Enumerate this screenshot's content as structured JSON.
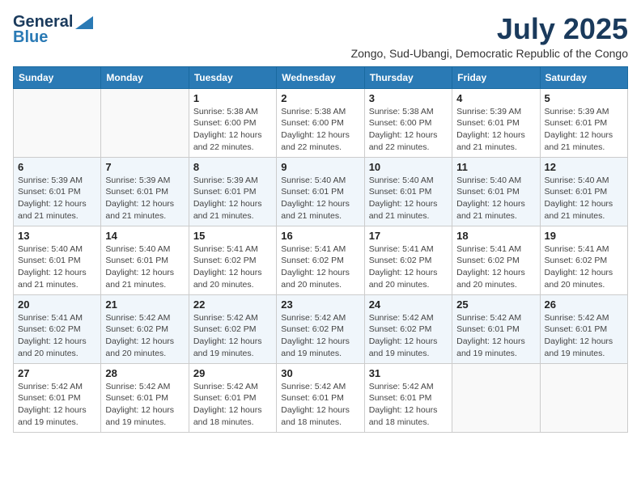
{
  "logo": {
    "line1": "General",
    "line2": "Blue"
  },
  "title": "July 2025",
  "location": "Zongo, Sud-Ubangi, Democratic Republic of the Congo",
  "weekdays": [
    "Sunday",
    "Monday",
    "Tuesday",
    "Wednesday",
    "Thursday",
    "Friday",
    "Saturday"
  ],
  "weeks": [
    [
      {
        "day": "",
        "info": ""
      },
      {
        "day": "",
        "info": ""
      },
      {
        "day": "1",
        "info": "Sunrise: 5:38 AM\nSunset: 6:00 PM\nDaylight: 12 hours and 22 minutes."
      },
      {
        "day": "2",
        "info": "Sunrise: 5:38 AM\nSunset: 6:00 PM\nDaylight: 12 hours and 22 minutes."
      },
      {
        "day": "3",
        "info": "Sunrise: 5:38 AM\nSunset: 6:00 PM\nDaylight: 12 hours and 22 minutes."
      },
      {
        "day": "4",
        "info": "Sunrise: 5:39 AM\nSunset: 6:01 PM\nDaylight: 12 hours and 21 minutes."
      },
      {
        "day": "5",
        "info": "Sunrise: 5:39 AM\nSunset: 6:01 PM\nDaylight: 12 hours and 21 minutes."
      }
    ],
    [
      {
        "day": "6",
        "info": "Sunrise: 5:39 AM\nSunset: 6:01 PM\nDaylight: 12 hours and 21 minutes."
      },
      {
        "day": "7",
        "info": "Sunrise: 5:39 AM\nSunset: 6:01 PM\nDaylight: 12 hours and 21 minutes."
      },
      {
        "day": "8",
        "info": "Sunrise: 5:39 AM\nSunset: 6:01 PM\nDaylight: 12 hours and 21 minutes."
      },
      {
        "day": "9",
        "info": "Sunrise: 5:40 AM\nSunset: 6:01 PM\nDaylight: 12 hours and 21 minutes."
      },
      {
        "day": "10",
        "info": "Sunrise: 5:40 AM\nSunset: 6:01 PM\nDaylight: 12 hours and 21 minutes."
      },
      {
        "day": "11",
        "info": "Sunrise: 5:40 AM\nSunset: 6:01 PM\nDaylight: 12 hours and 21 minutes."
      },
      {
        "day": "12",
        "info": "Sunrise: 5:40 AM\nSunset: 6:01 PM\nDaylight: 12 hours and 21 minutes."
      }
    ],
    [
      {
        "day": "13",
        "info": "Sunrise: 5:40 AM\nSunset: 6:01 PM\nDaylight: 12 hours and 21 minutes."
      },
      {
        "day": "14",
        "info": "Sunrise: 5:40 AM\nSunset: 6:01 PM\nDaylight: 12 hours and 21 minutes."
      },
      {
        "day": "15",
        "info": "Sunrise: 5:41 AM\nSunset: 6:02 PM\nDaylight: 12 hours and 20 minutes."
      },
      {
        "day": "16",
        "info": "Sunrise: 5:41 AM\nSunset: 6:02 PM\nDaylight: 12 hours and 20 minutes."
      },
      {
        "day": "17",
        "info": "Sunrise: 5:41 AM\nSunset: 6:02 PM\nDaylight: 12 hours and 20 minutes."
      },
      {
        "day": "18",
        "info": "Sunrise: 5:41 AM\nSunset: 6:02 PM\nDaylight: 12 hours and 20 minutes."
      },
      {
        "day": "19",
        "info": "Sunrise: 5:41 AM\nSunset: 6:02 PM\nDaylight: 12 hours and 20 minutes."
      }
    ],
    [
      {
        "day": "20",
        "info": "Sunrise: 5:41 AM\nSunset: 6:02 PM\nDaylight: 12 hours and 20 minutes."
      },
      {
        "day": "21",
        "info": "Sunrise: 5:42 AM\nSunset: 6:02 PM\nDaylight: 12 hours and 20 minutes."
      },
      {
        "day": "22",
        "info": "Sunrise: 5:42 AM\nSunset: 6:02 PM\nDaylight: 12 hours and 19 minutes."
      },
      {
        "day": "23",
        "info": "Sunrise: 5:42 AM\nSunset: 6:02 PM\nDaylight: 12 hours and 19 minutes."
      },
      {
        "day": "24",
        "info": "Sunrise: 5:42 AM\nSunset: 6:02 PM\nDaylight: 12 hours and 19 minutes."
      },
      {
        "day": "25",
        "info": "Sunrise: 5:42 AM\nSunset: 6:01 PM\nDaylight: 12 hours and 19 minutes."
      },
      {
        "day": "26",
        "info": "Sunrise: 5:42 AM\nSunset: 6:01 PM\nDaylight: 12 hours and 19 minutes."
      }
    ],
    [
      {
        "day": "27",
        "info": "Sunrise: 5:42 AM\nSunset: 6:01 PM\nDaylight: 12 hours and 19 minutes."
      },
      {
        "day": "28",
        "info": "Sunrise: 5:42 AM\nSunset: 6:01 PM\nDaylight: 12 hours and 19 minutes."
      },
      {
        "day": "29",
        "info": "Sunrise: 5:42 AM\nSunset: 6:01 PM\nDaylight: 12 hours and 18 minutes."
      },
      {
        "day": "30",
        "info": "Sunrise: 5:42 AM\nSunset: 6:01 PM\nDaylight: 12 hours and 18 minutes."
      },
      {
        "day": "31",
        "info": "Sunrise: 5:42 AM\nSunset: 6:01 PM\nDaylight: 12 hours and 18 minutes."
      },
      {
        "day": "",
        "info": ""
      },
      {
        "day": "",
        "info": ""
      }
    ]
  ]
}
